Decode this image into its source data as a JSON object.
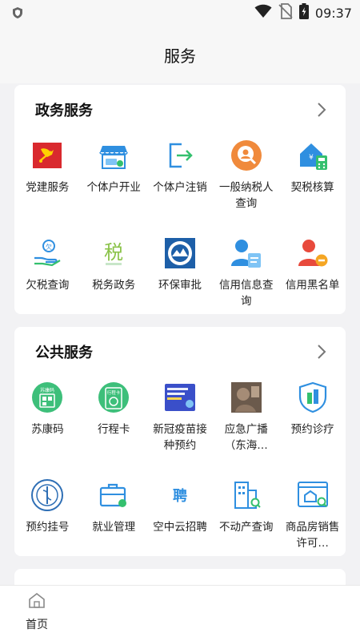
{
  "status_bar": {
    "time": "09:37",
    "icons": [
      "shield-icon",
      "wifi-icon",
      "no-sim-icon",
      "battery-icon"
    ]
  },
  "header": {
    "title": "服务"
  },
  "sections": [
    {
      "title": "政务服务",
      "items": [
        {
          "label": "党建服务",
          "icon": "party-flag-icon"
        },
        {
          "label": "个体户开业",
          "icon": "shop-icon"
        },
        {
          "label": "个体户注销",
          "icon": "exit-icon"
        },
        {
          "label": "一般纳税人查询",
          "icon": "user-search-icon"
        },
        {
          "label": "契税核算",
          "icon": "house-calculator-icon"
        },
        {
          "label": "欠税查询",
          "icon": "hand-coin-icon"
        },
        {
          "label": "税务政务",
          "icon": "tax-icon"
        },
        {
          "label": "环保审批",
          "icon": "environment-seal-icon"
        },
        {
          "label": "信用信息查询",
          "icon": "credit-user-icon"
        },
        {
          "label": "信用黑名单",
          "icon": "blacklist-user-icon"
        }
      ]
    },
    {
      "title": "公共服务",
      "items": [
        {
          "label": "苏康码",
          "icon": "health-code-icon"
        },
        {
          "label": "行程卡",
          "icon": "travel-card-icon"
        },
        {
          "label": "新冠疫苗接种预约",
          "icon": "vaccine-banner-icon"
        },
        {
          "label": "应急广播（东海…",
          "icon": "broadcast-photo-icon"
        },
        {
          "label": "预约诊疗",
          "icon": "shield-building-icon"
        },
        {
          "label": "预约挂号",
          "icon": "hospital-emblem-icon"
        },
        {
          "label": "就业管理",
          "icon": "briefcase-icon"
        },
        {
          "label": "空中云招聘",
          "icon": "recruit-icon"
        },
        {
          "label": "不动产查询",
          "icon": "building-search-icon"
        },
        {
          "label": "商品房销售许可…",
          "icon": "house-window-icon"
        }
      ]
    }
  ],
  "bottom_nav": [
    {
      "label": "首页",
      "icon": "home-icon"
    }
  ],
  "colors": {
    "accent_blue": "#2f8fe0",
    "red": "#d9292e",
    "green": "#34c06e",
    "orange": "#f08a3c"
  }
}
